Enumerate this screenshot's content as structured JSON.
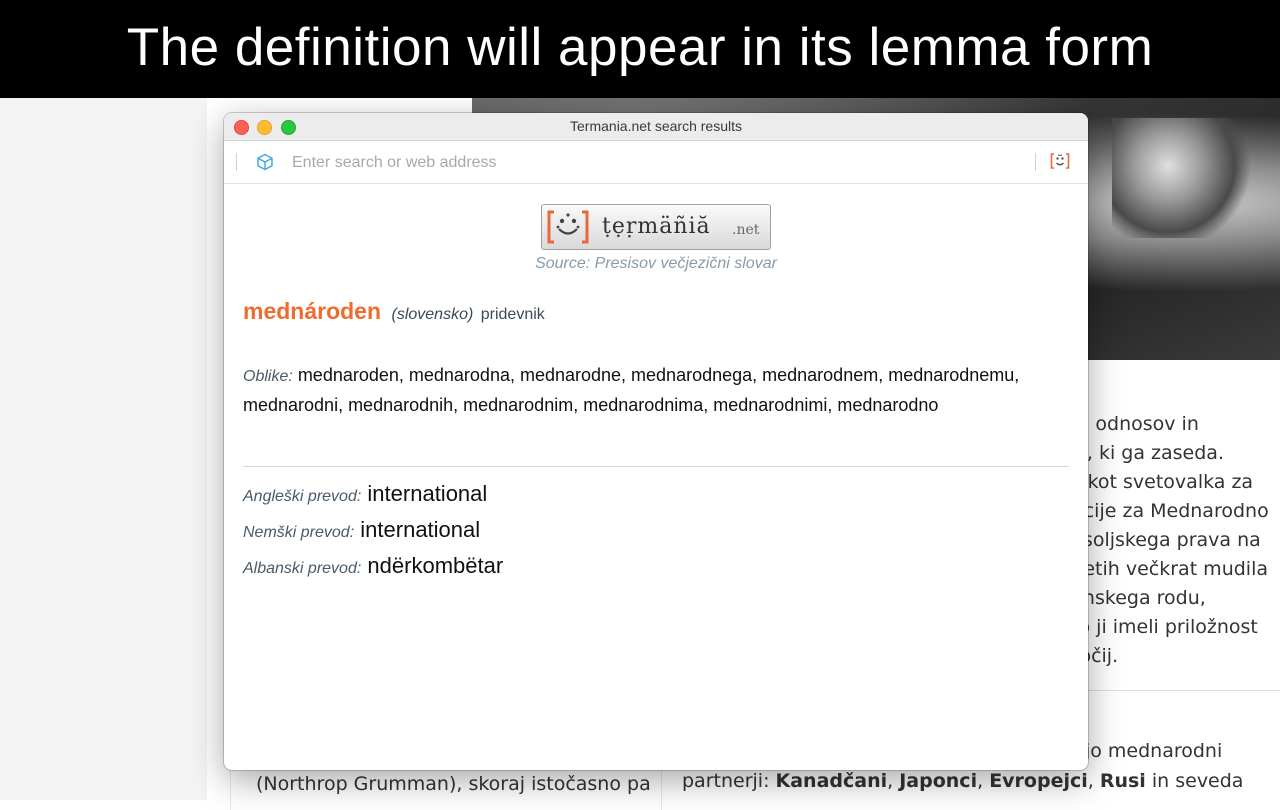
{
  "banner": {
    "text": "The definition will appear in its lemma form"
  },
  "background_article": {
    "lines": [
      "nih odnosov in",
      "žaj, ki ga zaseda.",
      "sa kot svetovalka za",
      "encije za Mednarodno",
      "vesoljskega prava na",
      "h letih večkrat mudila",
      "venskega rodu,",
      "mo ji imeli priložnost",
      "dročij."
    ],
    "fragment_right": "jejo mednarodni",
    "fragment_partners": {
      "prefix": "partnerji: ",
      "bold1": "Kanadčani",
      "sep1": ", ",
      "bold2": "Japonci",
      "sep2": ", ",
      "bold3": "Evropejci",
      "sep3": ", ",
      "bold4": "Rusi",
      "suffix": " in seveda"
    },
    "fragment_left": "(Northrop Grumman), skoraj istočasno pa"
  },
  "window": {
    "title": "Termania.net search results",
    "address_placeholder": "Enter search or web address",
    "address_value": ""
  },
  "logo": {
    "word": "ṭẹṛmäñiă",
    "suffix": ".net"
  },
  "source": "Source: Presisov večjezični slovar",
  "entry": {
    "headword": "mednároden",
    "language": "(slovensko)",
    "pos": "pridevnik",
    "forms_label": "Oblike:",
    "forms": "mednaroden, mednarodna, mednarodne, mednarodnega, mednarodnem, mednarodnemu, mednarodni, mednarodnih, mednarodnim, mednarodnima, mednarodnimi, mednarodno",
    "translations": [
      {
        "label": "Angleški prevod:",
        "value": "international"
      },
      {
        "label": "Nemški prevod:",
        "value": "international"
      },
      {
        "label": "Albanski prevod:",
        "value": "ndërkombëtar"
      }
    ]
  },
  "colors": {
    "headword": "#f26b2e",
    "source": "#8a9aaa",
    "banner_bg": "#000000"
  },
  "icons": {
    "address": "cube-icon",
    "extension": "termania-extension-icon"
  }
}
